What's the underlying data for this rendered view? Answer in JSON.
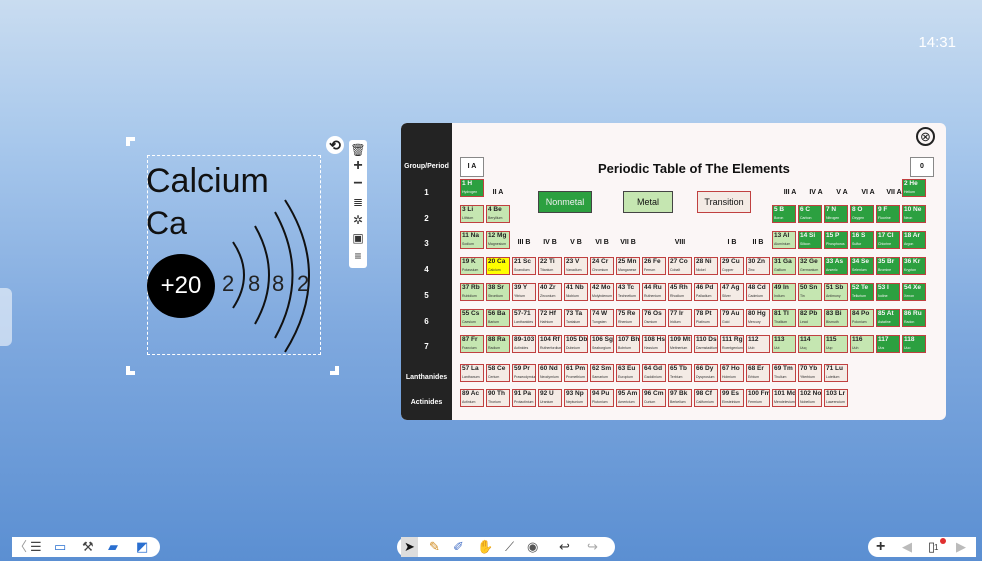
{
  "clock": "14:31",
  "calcium": {
    "name": "Calcium",
    "symbol": "Ca",
    "nucleus_label": "+20",
    "shells": [
      "2",
      "8",
      "8",
      "2"
    ]
  },
  "toolbar_side": {
    "icons": [
      "trash-icon",
      "plus-icon",
      "minus-icon",
      "align-icon",
      "gear-icon",
      "copy-icon",
      "menu-icon"
    ]
  },
  "periodic": {
    "title": "Periodic Table of The Elements",
    "close_icon": "⊗",
    "sidebar": {
      "header": "Group/Period",
      "periods": [
        "1",
        "2",
        "3",
        "4",
        "5",
        "6",
        "7"
      ],
      "lanthanides": "Lanthanides",
      "actinides": "Actinides"
    },
    "group_headers": {
      "IA": "I A",
      "IIA": "II A",
      "IIIB": "III B",
      "IVB": "IV B",
      "VB": "V B",
      "VIB": "VI B",
      "VIIB": "VII B",
      "VIII": "VIII",
      "IB": "I B",
      "IIB": "II B",
      "IIIA": "III A",
      "IVA": "IV A",
      "VA": "V A",
      "VIA": "VI A",
      "VIIA": "VII A",
      "O": "0"
    },
    "legend": {
      "nonmetal": "Nonmetal",
      "metal": "Metal",
      "transition": "Transition"
    },
    "colors": {
      "nonmetal": "#2ca040",
      "metal": "#c5e6b1",
      "transition": "#f4ebe5",
      "highlight": "#ffff00"
    }
  },
  "elements": [
    {
      "s": "1 H",
      "n": "Hydrogen",
      "t": "non",
      "c": 0,
      "r": 0
    },
    {
      "s": "2 He",
      "n": "Helium",
      "t": "non",
      "c": 17,
      "r": 0
    },
    {
      "s": "3 Li",
      "n": "Lithium",
      "t": "metal",
      "c": 0,
      "r": 1
    },
    {
      "s": "4 Be",
      "n": "Beryllium",
      "t": "metal",
      "c": 1,
      "r": 1
    },
    {
      "s": "5 B",
      "n": "Boron",
      "t": "non",
      "c": 12,
      "r": 1
    },
    {
      "s": "6 C",
      "n": "Carbon",
      "t": "non",
      "c": 13,
      "r": 1
    },
    {
      "s": "7 N",
      "n": "Nitrogen",
      "t": "non",
      "c": 14,
      "r": 1
    },
    {
      "s": "8 O",
      "n": "Oxygen",
      "t": "non",
      "c": 15,
      "r": 1
    },
    {
      "s": "9 F",
      "n": "Fluorine",
      "t": "non",
      "c": 16,
      "r": 1
    },
    {
      "s": "10 Ne",
      "n": "Neon",
      "t": "non",
      "c": 17,
      "r": 1
    },
    {
      "s": "11 Na",
      "n": "Sodium",
      "t": "metal",
      "c": 0,
      "r": 2
    },
    {
      "s": "12 Mg",
      "n": "Magnesium",
      "t": "metal",
      "c": 1,
      "r": 2
    },
    {
      "s": "13 Al",
      "n": "Aluminium",
      "t": "metal",
      "c": 12,
      "r": 2
    },
    {
      "s": "14 Si",
      "n": "Silicon",
      "t": "non",
      "c": 13,
      "r": 2
    },
    {
      "s": "15 P",
      "n": "Phosphorus",
      "t": "non",
      "c": 14,
      "r": 2
    },
    {
      "s": "16 S",
      "n": "Sulfur",
      "t": "non",
      "c": 15,
      "r": 2
    },
    {
      "s": "17 Cl",
      "n": "Chlorine",
      "t": "non",
      "c": 16,
      "r": 2
    },
    {
      "s": "18 Ar",
      "n": "Argon",
      "t": "non",
      "c": 17,
      "r": 2
    },
    {
      "s": "19 K",
      "n": "Potassium",
      "t": "metal",
      "c": 0,
      "r": 3
    },
    {
      "s": "20 Ca",
      "n": "Calcium",
      "t": "hl",
      "c": 1,
      "r": 3
    },
    {
      "s": "21 Sc",
      "n": "Scandium",
      "t": "trans",
      "c": 2,
      "r": 3
    },
    {
      "s": "22 Ti",
      "n": "Titanium",
      "t": "trans",
      "c": 3,
      "r": 3
    },
    {
      "s": "23 V",
      "n": "Vanadium",
      "t": "trans",
      "c": 4,
      "r": 3
    },
    {
      "s": "24 Cr",
      "n": "Chromium",
      "t": "trans",
      "c": 5,
      "r": 3
    },
    {
      "s": "25 Mn",
      "n": "Manganese",
      "t": "trans",
      "c": 6,
      "r": 3
    },
    {
      "s": "26 Fe",
      "n": "Ferrum",
      "t": "trans",
      "c": 7,
      "r": 3
    },
    {
      "s": "27 Co",
      "n": "Cobalt",
      "t": "trans",
      "c": 8,
      "r": 3
    },
    {
      "s": "28 Ni",
      "n": "Nickel",
      "t": "trans",
      "c": 9,
      "r": 3
    },
    {
      "s": "29 Cu",
      "n": "Copper",
      "t": "trans",
      "c": 10,
      "r": 3
    },
    {
      "s": "30 Zn",
      "n": "Zinc",
      "t": "trans",
      "c": 11,
      "r": 3
    },
    {
      "s": "31 Ga",
      "n": "Gallium",
      "t": "metal",
      "c": 12,
      "r": 3
    },
    {
      "s": "32 Ge",
      "n": "Germanium",
      "t": "metal",
      "c": 13,
      "r": 3
    },
    {
      "s": "33 As",
      "n": "Arsenic",
      "t": "non",
      "c": 14,
      "r": 3
    },
    {
      "s": "34 Se",
      "n": "Selenium",
      "t": "non",
      "c": 15,
      "r": 3
    },
    {
      "s": "35 Br",
      "n": "Bromine",
      "t": "non",
      "c": 16,
      "r": 3
    },
    {
      "s": "36 Kr",
      "n": "Krypton",
      "t": "non",
      "c": 17,
      "r": 3
    },
    {
      "s": "37 Rb",
      "n": "Rubidium",
      "t": "metal",
      "c": 0,
      "r": 4
    },
    {
      "s": "38 Sr",
      "n": "Strontium",
      "t": "metal",
      "c": 1,
      "r": 4
    },
    {
      "s": "39 Y",
      "n": "Yttrium",
      "t": "trans",
      "c": 2,
      "r": 4
    },
    {
      "s": "40 Zr",
      "n": "Zirconium",
      "t": "trans",
      "c": 3,
      "r": 4
    },
    {
      "s": "41 Nb",
      "n": "Niobium",
      "t": "trans",
      "c": 4,
      "r": 4
    },
    {
      "s": "42 Mo",
      "n": "Molybdenum",
      "t": "trans",
      "c": 5,
      "r": 4
    },
    {
      "s": "43 Tc",
      "n": "Technetium",
      "t": "trans",
      "c": 6,
      "r": 4
    },
    {
      "s": "44 Ru",
      "n": "Ruthenium",
      "t": "trans",
      "c": 7,
      "r": 4
    },
    {
      "s": "45 Rh",
      "n": "Rhodium",
      "t": "trans",
      "c": 8,
      "r": 4
    },
    {
      "s": "46 Pd",
      "n": "Palladium",
      "t": "trans",
      "c": 9,
      "r": 4
    },
    {
      "s": "47 Ag",
      "n": "Silver",
      "t": "trans",
      "c": 10,
      "r": 4
    },
    {
      "s": "48 Cd",
      "n": "Cadmium",
      "t": "trans",
      "c": 11,
      "r": 4
    },
    {
      "s": "49 In",
      "n": "Indium",
      "t": "metal",
      "c": 12,
      "r": 4
    },
    {
      "s": "50 Sn",
      "n": "Tin",
      "t": "metal",
      "c": 13,
      "r": 4
    },
    {
      "s": "51 Sb",
      "n": "Antimony",
      "t": "metal",
      "c": 14,
      "r": 4
    },
    {
      "s": "52 Te",
      "n": "Tellurium",
      "t": "non",
      "c": 15,
      "r": 4
    },
    {
      "s": "53 I",
      "n": "Iodine",
      "t": "non",
      "c": 16,
      "r": 4
    },
    {
      "s": "54 Xe",
      "n": "Xenon",
      "t": "non",
      "c": 17,
      "r": 4
    },
    {
      "s": "55 Cs",
      "n": "Caesium",
      "t": "metal",
      "c": 0,
      "r": 5
    },
    {
      "s": "56 Ba",
      "n": "Barium",
      "t": "metal",
      "c": 1,
      "r": 5
    },
    {
      "s": "57-71",
      "n": "Lanthanides",
      "t": "trans",
      "c": 2,
      "r": 5
    },
    {
      "s": "72 Hf",
      "n": "Hafnium",
      "t": "trans",
      "c": 3,
      "r": 5
    },
    {
      "s": "73 Ta",
      "n": "Tantalum",
      "t": "trans",
      "c": 4,
      "r": 5
    },
    {
      "s": "74 W",
      "n": "Tungsten",
      "t": "trans",
      "c": 5,
      "r": 5
    },
    {
      "s": "75 Re",
      "n": "Rhenium",
      "t": "trans",
      "c": 6,
      "r": 5
    },
    {
      "s": "76 Os",
      "n": "Osmium",
      "t": "trans",
      "c": 7,
      "r": 5
    },
    {
      "s": "77 Ir",
      "n": "Iridium",
      "t": "trans",
      "c": 8,
      "r": 5
    },
    {
      "s": "78 Pt",
      "n": "Platinum",
      "t": "trans",
      "c": 9,
      "r": 5
    },
    {
      "s": "79 Au",
      "n": "Gold",
      "t": "trans",
      "c": 10,
      "r": 5
    },
    {
      "s": "80 Hg",
      "n": "Mercury",
      "t": "trans",
      "c": 11,
      "r": 5
    },
    {
      "s": "81 Tl",
      "n": "Thallium",
      "t": "metal",
      "c": 12,
      "r": 5
    },
    {
      "s": "82 Pb",
      "n": "Lead",
      "t": "metal",
      "c": 13,
      "r": 5
    },
    {
      "s": "83 Bi",
      "n": "Bismuth",
      "t": "metal",
      "c": 14,
      "r": 5
    },
    {
      "s": "84 Po",
      "n": "Polonium",
      "t": "metal",
      "c": 15,
      "r": 5
    },
    {
      "s": "85 At",
      "n": "Astatine",
      "t": "non",
      "c": 16,
      "r": 5
    },
    {
      "s": "86 Ru",
      "n": "Radon",
      "t": "non",
      "c": 17,
      "r": 5
    },
    {
      "s": "87 Fr",
      "n": "Francium",
      "t": "metal",
      "c": 0,
      "r": 6
    },
    {
      "s": "88 Ra",
      "n": "Radium",
      "t": "metal",
      "c": 1,
      "r": 6
    },
    {
      "s": "89-103",
      "n": "Actinides",
      "t": "trans",
      "c": 2,
      "r": 6
    },
    {
      "s": "104 Rf",
      "n": "Rutherfordium",
      "t": "trans",
      "c": 3,
      "r": 6
    },
    {
      "s": "105 Db",
      "n": "Dubnium",
      "t": "trans",
      "c": 4,
      "r": 6
    },
    {
      "s": "106 Sg",
      "n": "Seaborgium",
      "t": "trans",
      "c": 5,
      "r": 6
    },
    {
      "s": "107 Bh",
      "n": "Bohrium",
      "t": "trans",
      "c": 6,
      "r": 6
    },
    {
      "s": "108 Hs",
      "n": "Hassium",
      "t": "trans",
      "c": 7,
      "r": 6
    },
    {
      "s": "109 Mt",
      "n": "Meitnerium",
      "t": "trans",
      "c": 8,
      "r": 6
    },
    {
      "s": "110 Ds",
      "n": "Darmstadtium",
      "t": "trans",
      "c": 9,
      "r": 6
    },
    {
      "s": "111 Rg",
      "n": "Roentgenium",
      "t": "trans",
      "c": 10,
      "r": 6
    },
    {
      "s": "112",
      "n": "Uub",
      "t": "trans",
      "c": 11,
      "r": 6
    },
    {
      "s": "113",
      "n": "Uut",
      "t": "metal",
      "c": 12,
      "r": 6
    },
    {
      "s": "114",
      "n": "Uuq",
      "t": "metal",
      "c": 13,
      "r": 6
    },
    {
      "s": "115",
      "n": "Uup",
      "t": "metal",
      "c": 14,
      "r": 6
    },
    {
      "s": "116",
      "n": "Uuh",
      "t": "metal",
      "c": 15,
      "r": 6
    },
    {
      "s": "117",
      "n": "Uus",
      "t": "non",
      "c": 16,
      "r": 6
    },
    {
      "s": "118",
      "n": "Uuo",
      "t": "non",
      "c": 17,
      "r": 6
    },
    {
      "s": "57 La",
      "n": "Lanthanum",
      "t": "trans",
      "c": 0,
      "r": 7
    },
    {
      "s": "58 Ce",
      "n": "Cerium",
      "t": "trans",
      "c": 1,
      "r": 7
    },
    {
      "s": "59 Pr",
      "n": "Praseodymium",
      "t": "trans",
      "c": 2,
      "r": 7
    },
    {
      "s": "60 Nd",
      "n": "Neodymium",
      "t": "trans",
      "c": 3,
      "r": 7
    },
    {
      "s": "61 Pm",
      "n": "Promethium",
      "t": "trans",
      "c": 4,
      "r": 7
    },
    {
      "s": "62 Sm",
      "n": "Samarium",
      "t": "trans",
      "c": 5,
      "r": 7
    },
    {
      "s": "63 Eu",
      "n": "Europium",
      "t": "trans",
      "c": 6,
      "r": 7
    },
    {
      "s": "64 Gd",
      "n": "Gadolinium",
      "t": "trans",
      "c": 7,
      "r": 7
    },
    {
      "s": "65 Tb",
      "n": "Terbium",
      "t": "trans",
      "c": 8,
      "r": 7
    },
    {
      "s": "66 Dy",
      "n": "Dysprosium",
      "t": "trans",
      "c": 9,
      "r": 7
    },
    {
      "s": "67 Ho",
      "n": "Holmium",
      "t": "trans",
      "c": 10,
      "r": 7
    },
    {
      "s": "68 Er",
      "n": "Erbium",
      "t": "trans",
      "c": 11,
      "r": 7
    },
    {
      "s": "69 Tm",
      "n": "Thulium",
      "t": "trans",
      "c": 12,
      "r": 7
    },
    {
      "s": "70 Yb",
      "n": "Ytterbium",
      "t": "trans",
      "c": 13,
      "r": 7
    },
    {
      "s": "71 Lu",
      "n": "Lutetium",
      "t": "trans",
      "c": 14,
      "r": 7
    },
    {
      "s": "89 Ac",
      "n": "Actinium",
      "t": "trans",
      "c": 0,
      "r": 8
    },
    {
      "s": "90 Th",
      "n": "Thorium",
      "t": "trans",
      "c": 1,
      "r": 8
    },
    {
      "s": "91 Pa",
      "n": "Protactinium",
      "t": "trans",
      "c": 2,
      "r": 8
    },
    {
      "s": "92 U",
      "n": "Uranium",
      "t": "trans",
      "c": 3,
      "r": 8
    },
    {
      "s": "93 Np",
      "n": "Neptunium",
      "t": "trans",
      "c": 4,
      "r": 8
    },
    {
      "s": "94 Pu",
      "n": "Plutonium",
      "t": "trans",
      "c": 5,
      "r": 8
    },
    {
      "s": "95 Am",
      "n": "Americium",
      "t": "trans",
      "c": 6,
      "r": 8
    },
    {
      "s": "96 Cm",
      "n": "Curium",
      "t": "trans",
      "c": 7,
      "r": 8
    },
    {
      "s": "97 Bk",
      "n": "Berkelium",
      "t": "trans",
      "c": 8,
      "r": 8
    },
    {
      "s": "98 Cf",
      "n": "Californium",
      "t": "trans",
      "c": 9,
      "r": 8
    },
    {
      "s": "99 Es",
      "n": "Einsteinium",
      "t": "trans",
      "c": 10,
      "r": 8
    },
    {
      "s": "100 Fm",
      "n": "Fermium",
      "t": "trans",
      "c": 11,
      "r": 8
    },
    {
      "s": "101 Md",
      "n": "Mendelevium",
      "t": "trans",
      "c": 12,
      "r": 8
    },
    {
      "s": "102 No",
      "n": "Nobelium",
      "t": "trans",
      "c": 13,
      "r": 8
    },
    {
      "s": "103 Lr",
      "n": "Lawrencium",
      "t": "trans",
      "c": 14,
      "r": 8
    }
  ],
  "bottom": {
    "left_icons": [
      "chevron-left-icon",
      "menu-icon",
      "screen-icon",
      "tools-icon",
      "folder-icon",
      "image-icon"
    ],
    "mid_icons": [
      "pointer-icon",
      "pen-icon",
      "highlighter-icon",
      "hand-icon",
      "brush-icon",
      "speaker-icon",
      "undo-icon",
      "redo-icon"
    ],
    "right_icons": [
      "add-page-icon",
      "prev-page-icon",
      "page-icon",
      "next-page-icon"
    ],
    "page_number": "1"
  }
}
